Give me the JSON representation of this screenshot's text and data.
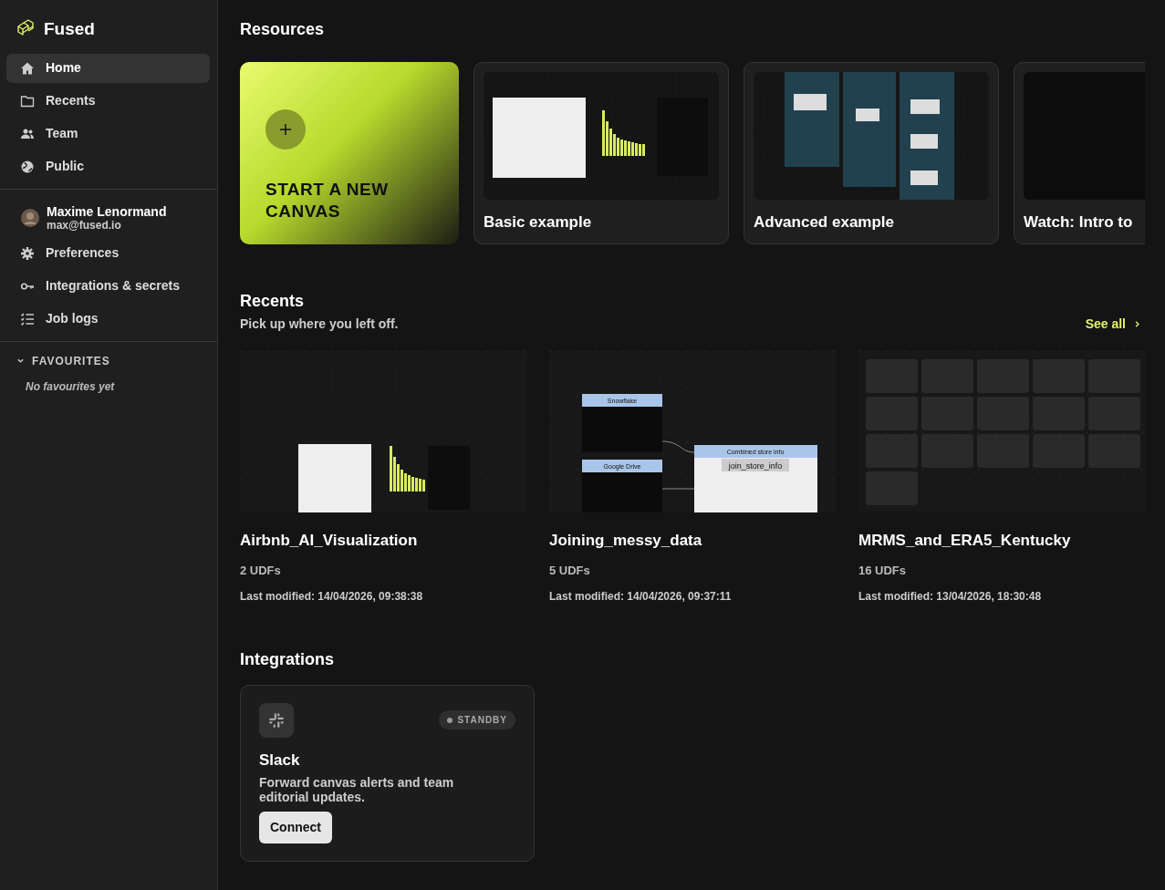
{
  "sidebar": {
    "brand": "Fused",
    "nav": [
      {
        "label": "Home",
        "kind": "home",
        "selected": true
      },
      {
        "label": "Recents",
        "kind": "folder",
        "selected": false
      },
      {
        "label": "Team",
        "kind": "people",
        "selected": false
      },
      {
        "label": "Public",
        "kind": "globe",
        "selected": false
      }
    ],
    "user": {
      "name": "Maxime Lenormand",
      "email": "max@fused.io"
    },
    "settings": [
      {
        "label": "Preferences",
        "kind": "gear"
      },
      {
        "label": "Integrations & secrets",
        "kind": "key"
      },
      {
        "label": "Job logs",
        "kind": "checklist"
      }
    ],
    "favourites": {
      "title": "FAVOURITES",
      "expanded": true,
      "empty_text": "No favourites yet"
    }
  },
  "resources": {
    "title": "Resources",
    "new_canvas": "START A NEW CANVAS",
    "items": [
      {
        "title": "Basic example",
        "kind": "basic"
      },
      {
        "title": "Advanced example",
        "kind": "advanced"
      },
      {
        "title": "Watch: Intro to",
        "kind": "video"
      }
    ]
  },
  "recents": {
    "title": "Recents",
    "subtitle": "Pick up where you left off.",
    "see_all": "See all",
    "items": [
      {
        "name": "Airbnb_AI_Visualization",
        "udfs": "2 UDFs",
        "modified": "Last modified: 14/04/2026, 09:38:38",
        "kind": "chart"
      },
      {
        "name": "Joining_messy_data",
        "udfs": "5 UDFs",
        "modified": "Last modified: 14/04/2026, 09:37:11",
        "kind": "nodes",
        "nodes": [
          "Snowflake",
          "Google Drive",
          "Combined store info",
          "join_store_info"
        ]
      },
      {
        "name": "MRMS_and_ERA5_Kentucky",
        "udfs": "16 UDFs",
        "modified": "Last modified: 13/04/2026, 18:30:48",
        "kind": "grid"
      }
    ]
  },
  "integrations": {
    "title": "Integrations",
    "items": [
      {
        "name": "Slack",
        "description": "Forward canvas alerts and team editorial updates.",
        "status": "STANDBY",
        "button": "Connect"
      }
    ]
  }
}
